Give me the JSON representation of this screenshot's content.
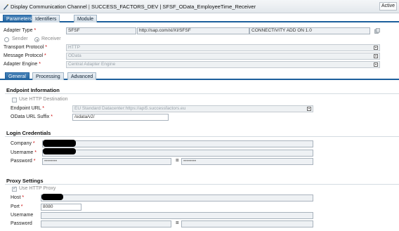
{
  "window": {
    "title": "Display Communication Channel",
    "path": "SUCCESS_FACTORS_DEV | SFSF_OData_EmployeeTime_Receiver",
    "status": "Active"
  },
  "top_tabs": [
    "Parameters",
    "Identifiers",
    "Module"
  ],
  "adapter": {
    "type_label": "Adapter Type",
    "type_value": "SFSF",
    "namespace_value": "http://sap.com/xi/XI/SFSF",
    "software_component_value": "CONNECTIVITY ADD ON 1.0",
    "sender_label": "Sender",
    "receiver_label": "Receiver",
    "transport_protocol_label": "Transport Protocol",
    "transport_protocol_value": "HTTP",
    "message_protocol_label": "Message Protocol",
    "message_protocol_value": "OData",
    "adapter_engine_label": "Adapter Engine",
    "adapter_engine_value": "Central Adapter Engine"
  },
  "sub_tabs": [
    "General",
    "Processing",
    "Advanced"
  ],
  "endpoint": {
    "heading": "Endpoint Information",
    "use_http_destination_label": "Use HTTP Destination",
    "url_label": "Endpoint URL",
    "url_value": "EU Standard Datacenter:https://api5.successfactors.eu",
    "suffix_label": "OData URL Suffix",
    "suffix_value": "/odata/v2/"
  },
  "credentials": {
    "heading": "Login Credentials",
    "company_label": "Company",
    "company_value": "",
    "username_label": "Username",
    "username_value": "",
    "password_label": "Password",
    "password_value": "••••••••",
    "password_confirm_value": "••••••••",
    "eq": "="
  },
  "proxy": {
    "heading": "Proxy Settings",
    "use_http_proxy_label": "Use HTTP Proxy",
    "host_label": "Host",
    "host_value": "",
    "port_label": "Port",
    "port_value": "8080",
    "username_label": "Username",
    "username_value": "",
    "password_label": "Password",
    "password_value": "",
    "password_confirm_value": "",
    "eq": "="
  },
  "required_marker": "*",
  "icons": [
    "communication-channel-icon",
    "copy-icon",
    "dropdown-icon",
    "checkbox",
    "radio"
  ],
  "colors": {
    "tab_active": "#1c5f9c",
    "required": "#cc0000",
    "field_bg": "#eef1f4"
  }
}
